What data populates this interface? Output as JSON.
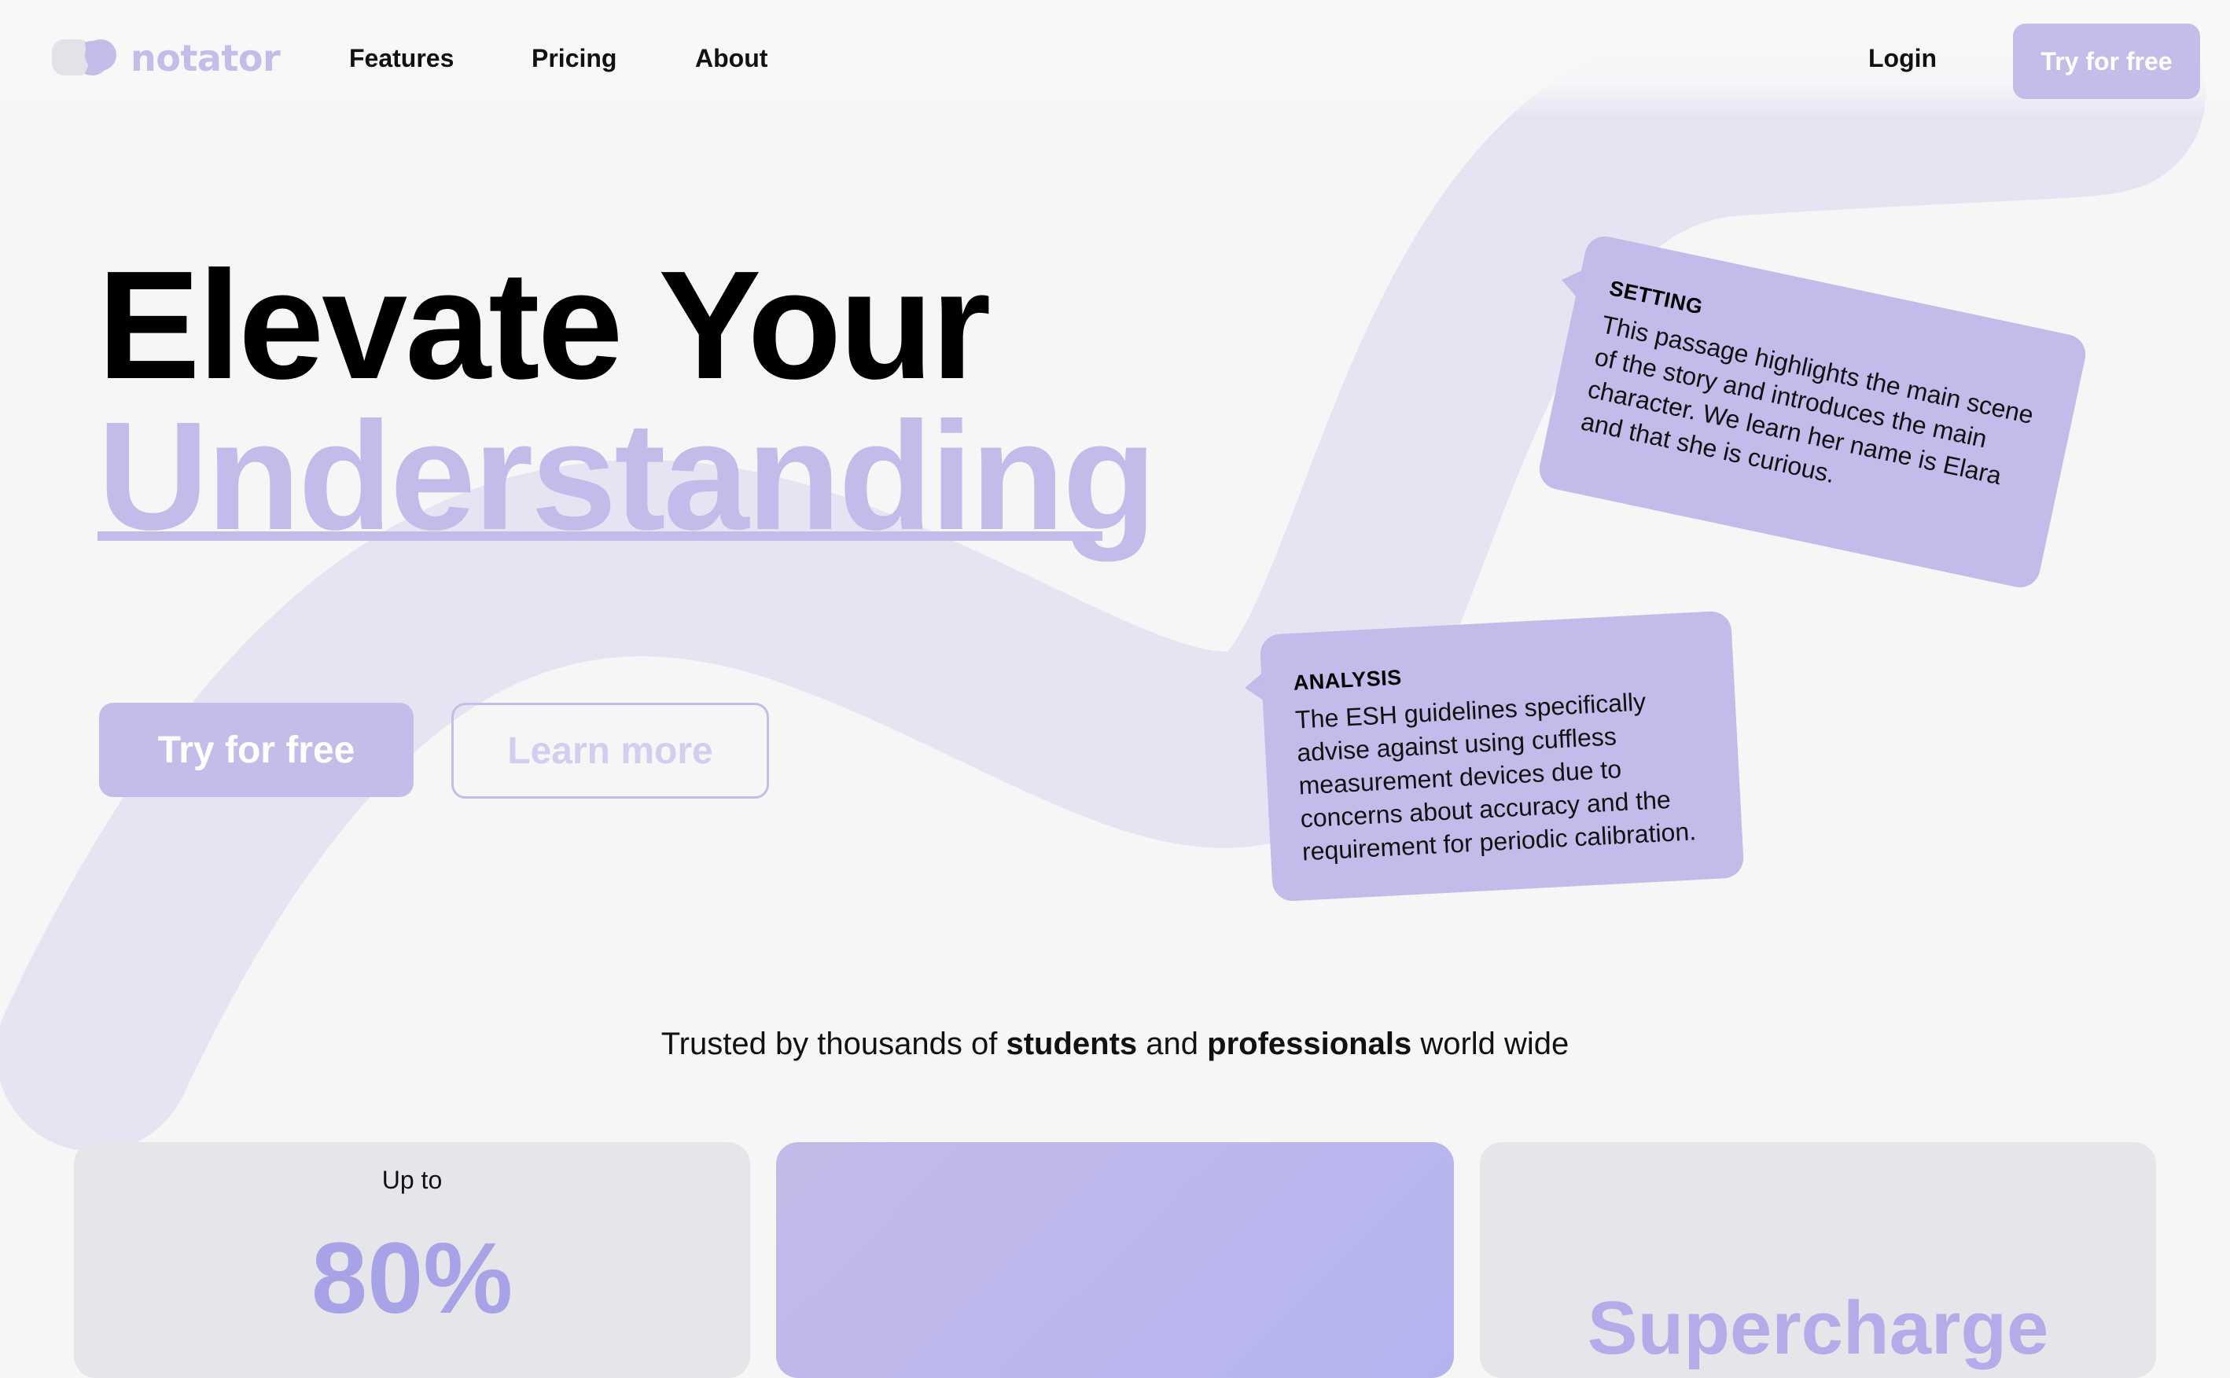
{
  "brand": {
    "name": "notator",
    "accent": "#c4bde9",
    "logo_icon": "chat-bubbles-icon"
  },
  "nav": {
    "links": [
      "Features",
      "Pricing",
      "About"
    ],
    "login": "Login",
    "cta": "Try for free"
  },
  "hero": {
    "line1": "Elevate Your",
    "line2": "Understanding",
    "primary_button": "Try for free",
    "secondary_button": "Learn more"
  },
  "notes": {
    "setting": {
      "title": "SETTING",
      "body": "This passage highlights the main scene of the story and introduces the main character. We learn her name is Elara and that she is curious."
    },
    "analysis": {
      "title": "ANALYSIS",
      "body": "The ESH guidelines specifically advise against using cuffless measurement devices due to concerns about accuracy and the requirement for periodic calibration."
    }
  },
  "trust": {
    "prefix": "Trusted by thousands of ",
    "strong1": "students",
    "middle": " and ",
    "strong2": "professionals",
    "suffix": " world wide"
  },
  "stats": {
    "card1_label": "Up to",
    "card1_value": "80%",
    "card3_text": "Supercharge"
  }
}
